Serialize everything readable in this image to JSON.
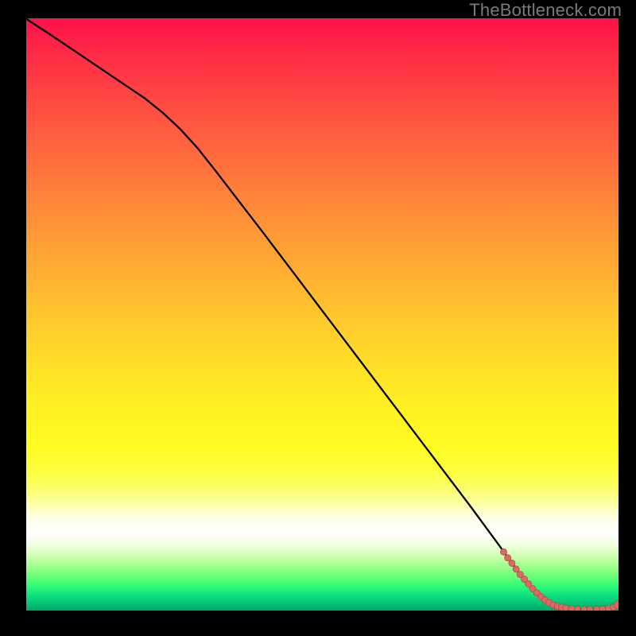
{
  "watermark": "TheBottleneck.com",
  "colors": {
    "line": "#000000",
    "marker_fill": "#d86a63",
    "marker_stroke": "#b34a45",
    "background_top": "#ff1049",
    "background_bottom": "#03a768",
    "frame": "#000000"
  },
  "chart_data": {
    "type": "line",
    "title": "",
    "xlabel": "",
    "ylabel": "",
    "xlim": [
      0,
      100
    ],
    "ylim": [
      0,
      100
    ],
    "series": [
      {
        "name": "bottleneck-curve",
        "x": [
          0,
          4,
          8,
          12,
          16,
          20,
          23,
          26,
          29,
          32,
          36,
          40,
          45,
          50,
          55,
          60,
          65,
          70,
          75,
          80,
          82,
          84,
          86,
          88,
          90,
          92,
          94,
          95.5,
          97,
          98.3,
          99.3,
          100
        ],
        "y": [
          99.9,
          97.3,
          94.6,
          91.9,
          89.2,
          86.5,
          84.1,
          81.3,
          78.0,
          74.2,
          69.0,
          63.8,
          57.2,
          50.6,
          44.0,
          37.4,
          30.8,
          24.2,
          17.6,
          10.8,
          8.0,
          5.3,
          3.0,
          1.3,
          0.55,
          0.3,
          0.22,
          0.22,
          0.25,
          0.35,
          0.55,
          1.0
        ]
      }
    ],
    "markers": {
      "name": "dense-region",
      "x": [
        80.6,
        81.3,
        82.0,
        82.7,
        83.4,
        84.1,
        84.8,
        85.5,
        86.2,
        86.9,
        87.6,
        88.3,
        89.0,
        89.7,
        90.4,
        91.1,
        92.1,
        93.1,
        94.2,
        95.2,
        96.3,
        97.3,
        98.3,
        99.1,
        100.0
      ],
      "y": [
        9.9,
        8.9,
        8.0,
        7.0,
        6.1,
        5.3,
        4.5,
        3.7,
        3.0,
        2.35,
        1.8,
        1.32,
        0.95,
        0.72,
        0.55,
        0.44,
        0.33,
        0.26,
        0.22,
        0.22,
        0.24,
        0.28,
        0.37,
        0.58,
        1.0
      ],
      "r": [
        4.1,
        4.1,
        4.1,
        4.1,
        4.1,
        4.1,
        4.1,
        4.1,
        4.1,
        4.1,
        4.1,
        4.1,
        4.1,
        4.1,
        4.1,
        3.8,
        3.8,
        3.8,
        3.8,
        3.8,
        3.8,
        3.8,
        3.8,
        3.8,
        5.6
      ]
    }
  }
}
